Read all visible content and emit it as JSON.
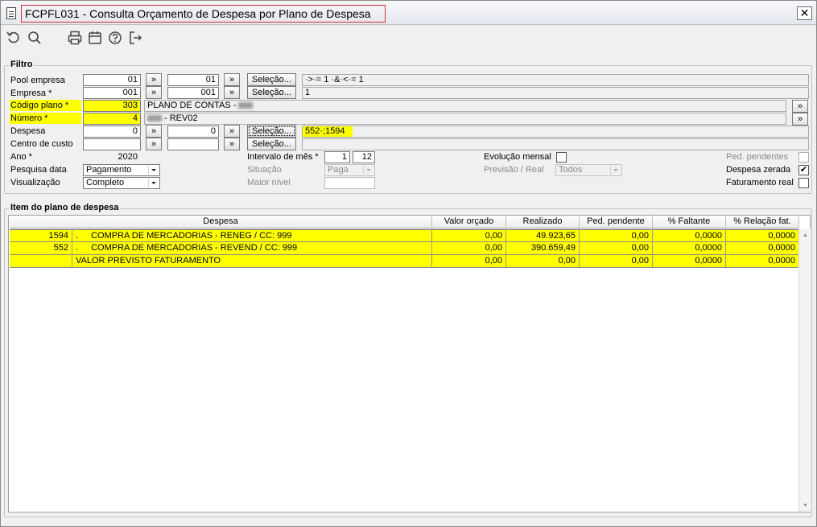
{
  "window": {
    "title": "FCPFL031 - Consulta Orçamento de Despesa por Plano de Despesa",
    "close": "✕"
  },
  "toolbar": {
    "icons": [
      "refresh-icon",
      "search-icon",
      "print-icon",
      "calendar-icon",
      "help-icon",
      "exit-icon"
    ]
  },
  "filtro": {
    "title": "Filtro",
    "pool_empresa": {
      "label": "Pool empresa",
      "from": "01",
      "to": "01",
      "jump": "»",
      "selection_label": "Seleção...",
      "criteria": "·>·= 1 ·&·<·= 1"
    },
    "empresa": {
      "label": "Empresa *",
      "from": "001",
      "to": "001",
      "jump": "»",
      "selection_label": "Seleção...",
      "criteria": "1"
    },
    "codigo_plano": {
      "label": "Código plano *",
      "value": "303",
      "description": "PLANO DE CONTAS -",
      "jump": "»"
    },
    "numero": {
      "label": "Número *",
      "value": "4",
      "description": "- REV02",
      "jump": "»"
    },
    "despesa": {
      "label": "Despesa",
      "from": "0",
      "to": "0",
      "jump": "»",
      "selection_label": "Seleção...",
      "criteria": "552·;1594"
    },
    "centro_custo": {
      "label": "Centro de custo",
      "from": "",
      "to": "",
      "jump": "»",
      "selection_label": "Seleção...",
      "criteria": ""
    },
    "ano": {
      "label": "Ano *",
      "value": "2020"
    },
    "pesquisa_data": {
      "label": "Pesquisa data",
      "value": "Pagamento"
    },
    "visualizacao": {
      "label": "Visualização",
      "value": "Completo"
    },
    "intervalo_mes": {
      "label": "Intervalo de mês *",
      "from": "1",
      "to": "12"
    },
    "situacao": {
      "label": "Situação",
      "value": "Paga"
    },
    "maior_nivel": {
      "label": "Maior nível",
      "value": ""
    },
    "evolucao_mensal": {
      "label": "Evolução mensal",
      "checked": false
    },
    "previsao_real": {
      "label": "Previsão / Real",
      "value": "Todos"
    },
    "ped_pendentes": {
      "label": "Ped. pendentes",
      "checked": false
    },
    "despesa_zerada": {
      "label": "Despesa zerada",
      "checked": true,
      "mark": "✔"
    },
    "faturamento_real": {
      "label": "Faturamento real",
      "checked": false
    }
  },
  "items": {
    "title": "Item do plano de despesa",
    "columns": [
      "Despesa",
      "Valor orçado",
      "Realizado",
      "Ped. pendente",
      "% Faltante",
      "% Relação fat."
    ],
    "rows": [
      {
        "code": "1594",
        "dot": ".",
        "name": "COMPRA DE MERCADORIAS - RENEG / CC: 999",
        "valor_orcado": "0,00",
        "realizado": "49.923,65",
        "ped_pendente": "0,00",
        "faltante": "0,0000",
        "relacao_fat": "0,0000"
      },
      {
        "code": "552",
        "dot": ".",
        "name": "COMPRA DE MERCADORIAS - REVEND / CC: 999",
        "valor_orcado": "0,00",
        "realizado": "390.659,49",
        "ped_pendente": "0,00",
        "faltante": "0,0000",
        "relacao_fat": "0,0000"
      },
      {
        "code": "",
        "dot": "",
        "name": "VALOR PREVISTO FATURAMENTO",
        "valor_orcado": "0,00",
        "realizado": "0,00",
        "ped_pendente": "0,00",
        "faltante": "0,0000",
        "relacao_fat": "0,0000"
      }
    ],
    "scroll_up": "▲",
    "scroll_down": "▼"
  }
}
